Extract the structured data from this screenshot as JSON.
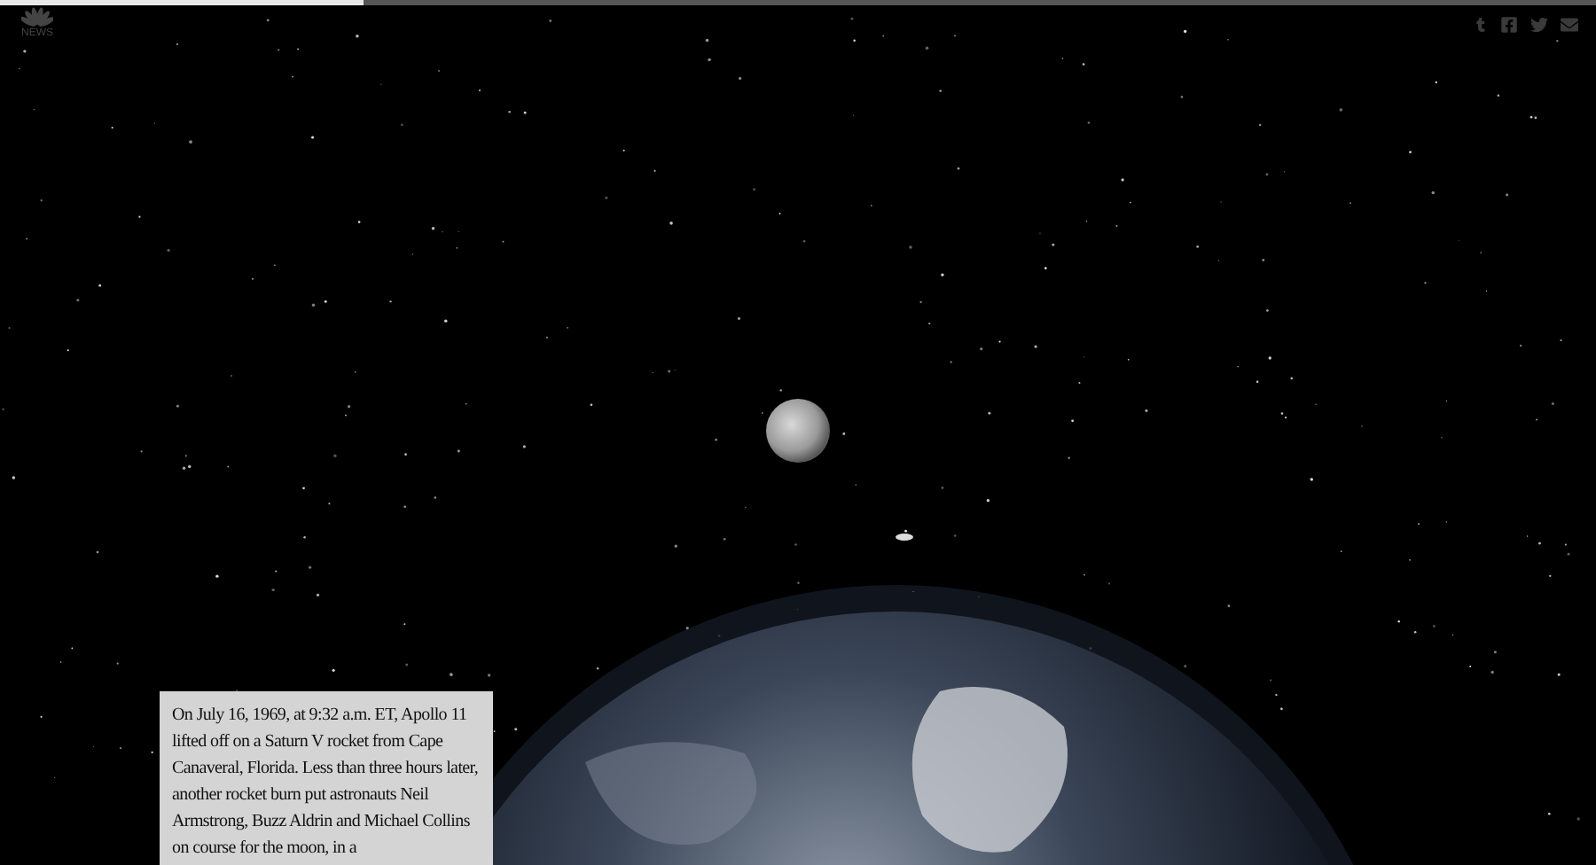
{
  "progress": {
    "level": 0.228
  },
  "logo": {
    "text": "NEWS"
  },
  "caption": {
    "text": "On July 16, 1969, at 9:32 a.m. ET, Apollo 11 lifted off on a Saturn V rocket from Cape Canaveral, Florida. Less than three hours later, another rocket burn put astronauts Neil Armstrong, Buzz Aldrin and Michael Collins on course for the moon, in a"
  }
}
